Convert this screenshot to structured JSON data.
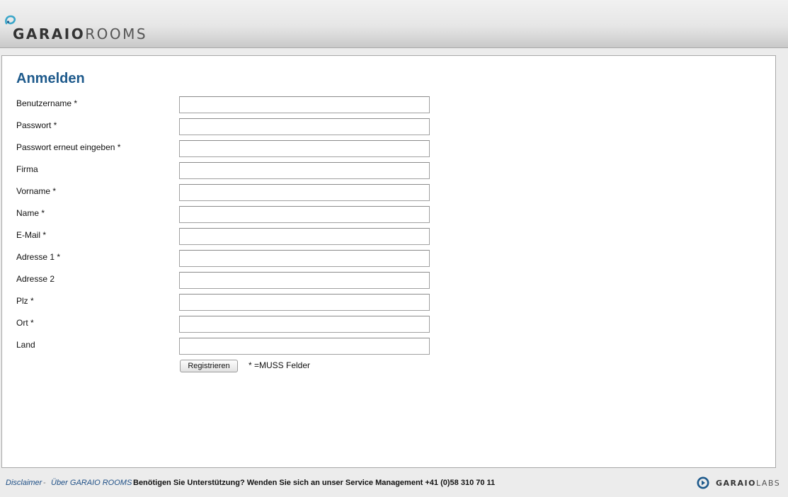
{
  "header": {
    "logo_icon": "garaio-swirl-icon",
    "logo_bold": "GARAIO",
    "logo_light": "ROOMS"
  },
  "form": {
    "title": "Anmelden",
    "fields": [
      {
        "label": "Benutzername *",
        "value": ""
      },
      {
        "label": "Passwort *",
        "value": ""
      },
      {
        "label": "Passwort erneut eingeben *",
        "value": ""
      },
      {
        "label": "Firma",
        "value": ""
      },
      {
        "label": "Vorname *",
        "value": ""
      },
      {
        "label": "Name *",
        "value": ""
      },
      {
        "label": "E-Mail *",
        "value": ""
      },
      {
        "label": "Adresse 1 *",
        "value": ""
      },
      {
        "label": "Adresse 2",
        "value": ""
      },
      {
        "label": "Plz *",
        "value": ""
      },
      {
        "label": "Ort *",
        "value": ""
      },
      {
        "label": "Land",
        "value": ""
      }
    ],
    "submit_label": "Registrieren",
    "required_note": "* =MUSS Felder"
  },
  "footer": {
    "disclaimer": "Disclaimer",
    "separator": "-",
    "about": "Über GARAIO ROOMS",
    "support": "Benötigen Sie Unterstützung? Wenden Sie sich an unser Service Management +41 (0)58 310 70 11",
    "labs_icon": "garaio-labs-icon",
    "labs_bold": "GARAIO",
    "labs_light": "LABS"
  },
  "colors": {
    "title": "#1e5a8c",
    "link": "#1e4f86",
    "logo_teal": "#3aa6c9",
    "labs_blue": "#1e5a8c"
  }
}
